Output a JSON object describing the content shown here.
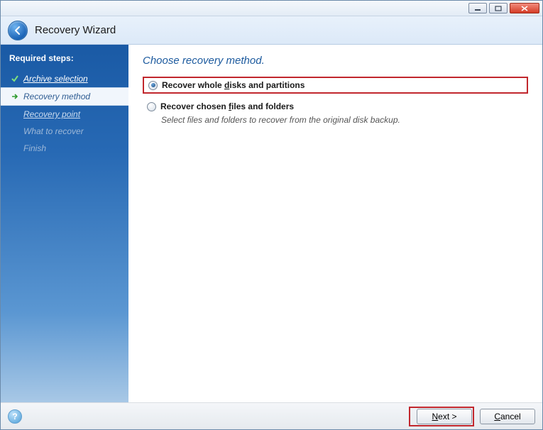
{
  "window": {
    "title": "Recovery Wizard"
  },
  "sidebar": {
    "title": "Required steps:",
    "steps": [
      {
        "label": "Archive selection",
        "state": "completed"
      },
      {
        "label": "Recovery method",
        "state": "current"
      },
      {
        "label": "Recovery point",
        "state": "upcoming"
      },
      {
        "label": "What to recover",
        "state": "disabled"
      },
      {
        "label": "Finish",
        "state": "disabled"
      }
    ]
  },
  "content": {
    "heading": "Choose recovery method.",
    "options": [
      {
        "label_pre": "Recover whole ",
        "label_ul": "d",
        "label_post": "isks and partitions",
        "selected": true,
        "highlighted": true,
        "description": ""
      },
      {
        "label_pre": "Recover chosen ",
        "label_ul": "f",
        "label_post": "iles and folders",
        "selected": false,
        "highlighted": false,
        "description": "Select files and folders to recover from the original disk backup."
      }
    ]
  },
  "footer": {
    "help": "?",
    "next_pre": "",
    "next_ul": "N",
    "next_post": "ext >",
    "cancel_pre": "",
    "cancel_ul": "C",
    "cancel_post": "ancel",
    "next_highlighted": true
  }
}
